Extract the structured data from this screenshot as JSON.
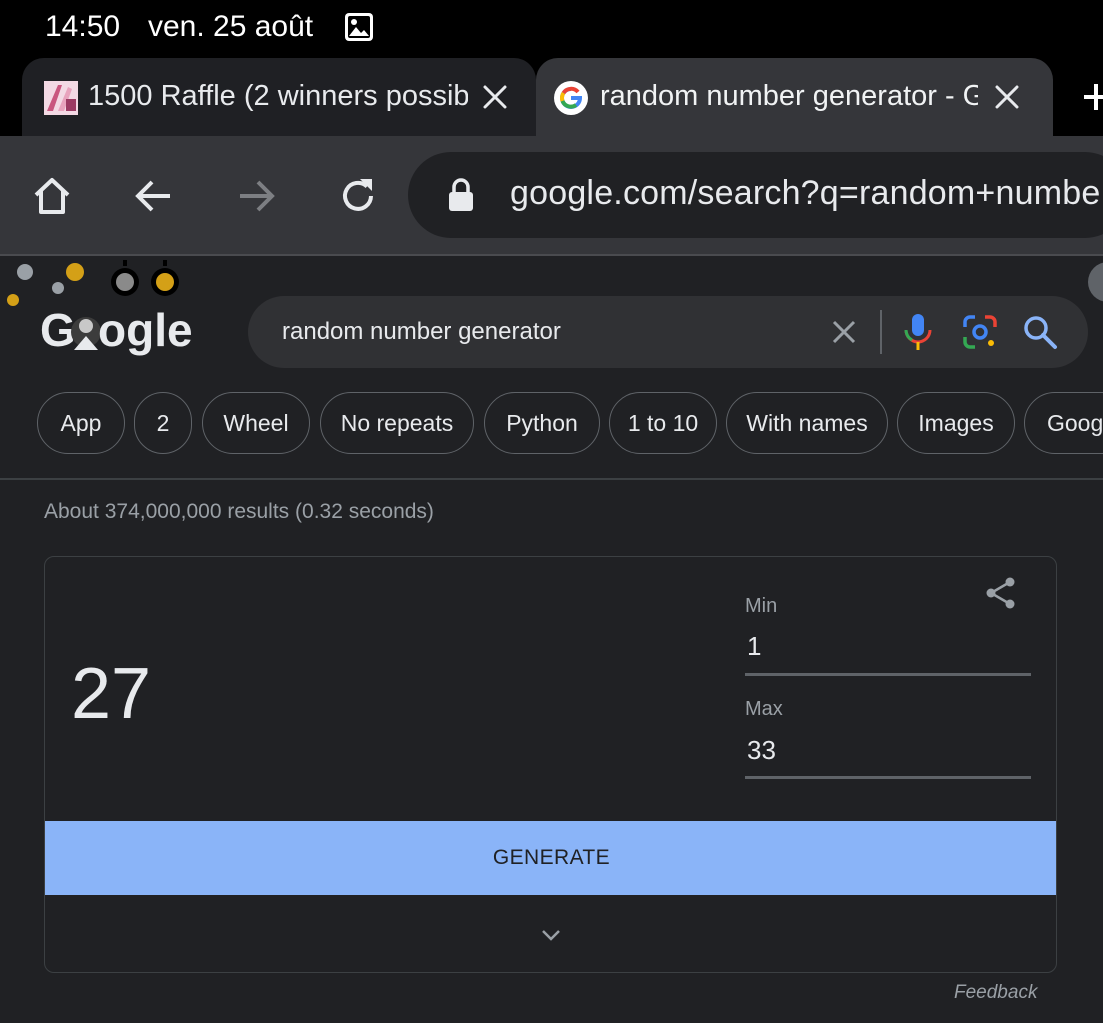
{
  "status_bar": {
    "time": "14:50",
    "date": "ven. 25 août",
    "gallery_icon": "image-icon"
  },
  "tabs": [
    {
      "title": "1500 Raffle (2 winners possib",
      "favicon": "pink-thumbnail",
      "active": false
    },
    {
      "title": "random number generator - G",
      "favicon": "google-g-icon",
      "active": true
    }
  ],
  "toolbar": {
    "home_icon": "home-icon",
    "back_icon": "arrow-back-icon",
    "forward_icon": "arrow-forward-icon",
    "reload_icon": "reload-icon",
    "url": "google.com/search?q=random+numbe"
  },
  "google": {
    "logo_text": "Google",
    "query": "random number generator",
    "chips": [
      "App",
      "2",
      "Wheel",
      "No repeats",
      "Python",
      "1 to 10",
      "With names",
      "Images",
      "Goog"
    ],
    "results_count": "About 374,000,000 results (0.32 seconds)"
  },
  "rng": {
    "result": "27",
    "min_label": "Min",
    "min_value": "1",
    "max_label": "Max",
    "max_value": "33",
    "generate_label": "GENERATE",
    "feedback_label": "Feedback"
  },
  "colors": {
    "background": "#202124",
    "accent": "#8ab4f8",
    "toolbar": "#35363a"
  }
}
